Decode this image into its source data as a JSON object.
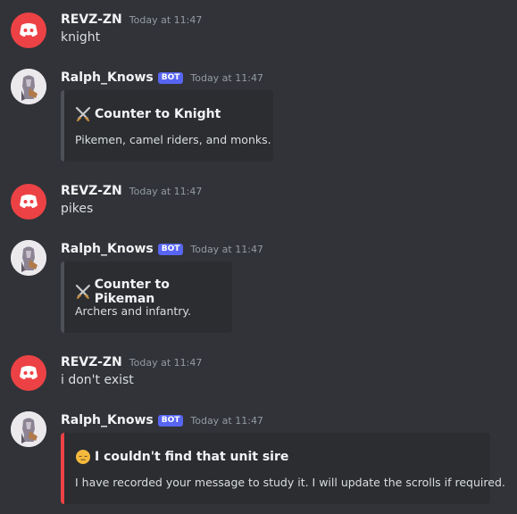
{
  "messages": [
    {
      "username": "REVZ-ZN",
      "timestamp": "Today at 11:47",
      "text": "knight"
    },
    {
      "username": "Ralph_Knows",
      "bot_tag": "BOT",
      "timestamp": "Today at 11:47",
      "embed": {
        "icon": "crossed-swords-icon",
        "title": "Counter to Knight",
        "description": "Pikemen, camel riders, and monks."
      }
    },
    {
      "username": "REVZ-ZN",
      "timestamp": "Today at 11:47",
      "text": "pikes"
    },
    {
      "username": "Ralph_Knows",
      "bot_tag": "BOT",
      "timestamp": "Today at 11:47",
      "embed": {
        "icon": "crossed-swords-icon",
        "title": "Counter to Pikeman",
        "description": "Archers and infantry."
      }
    },
    {
      "username": "REVZ-ZN",
      "timestamp": "Today at 11:47",
      "text": "i don't exist"
    },
    {
      "username": "Ralph_Knows",
      "bot_tag": "BOT",
      "timestamp": "Today at 11:47",
      "embed": {
        "icon": "pensive-face-icon",
        "title": "I couldn't find that unit sire",
        "description": "I have recorded your message to study it. I will update the scrolls if required.",
        "accent_color": "#ed4245"
      }
    }
  ],
  "colors": {
    "background": "#313338",
    "embed_background": "#2b2d31",
    "discord_avatar": "#ed4245",
    "bot_tag": "#5865f2",
    "timestamp": "#949ba4"
  }
}
